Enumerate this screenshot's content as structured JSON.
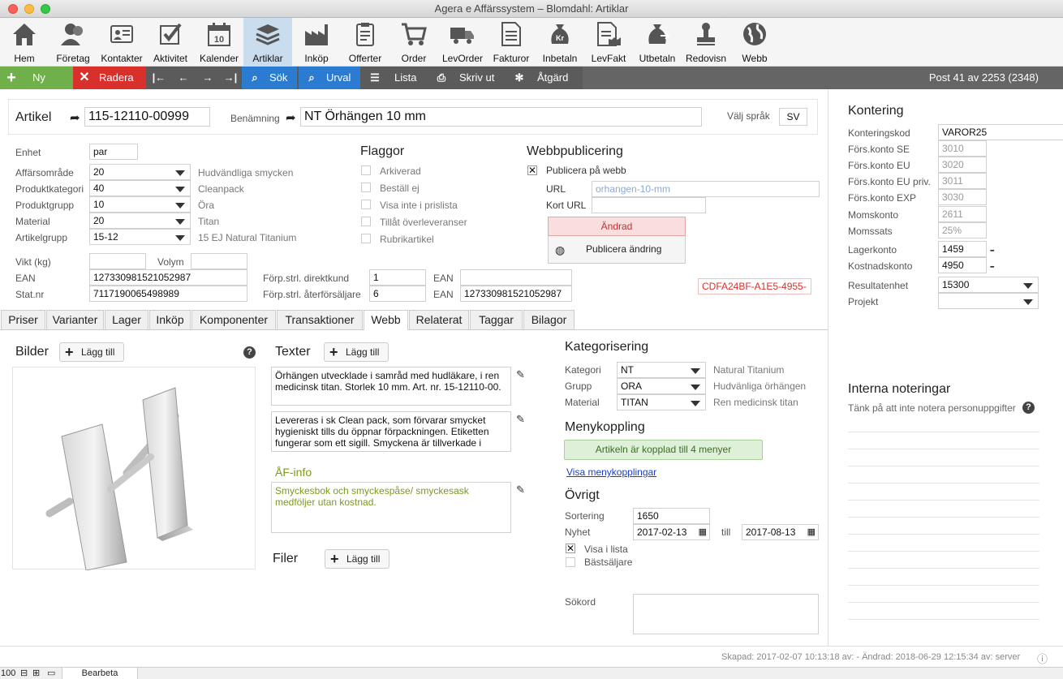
{
  "window": {
    "title": "Agera e Affärssystem – Blomdahl: Artiklar"
  },
  "toolbar": [
    {
      "label": "Hem",
      "icon": "home-icon"
    },
    {
      "label": "Företag",
      "icon": "company-icon"
    },
    {
      "label": "Kontakter",
      "icon": "contacts-icon"
    },
    {
      "label": "Aktivitet",
      "icon": "activity-icon"
    },
    {
      "label": "Kalender",
      "icon": "calendar-icon"
    },
    {
      "label": "Artiklar",
      "icon": "articles-icon"
    },
    {
      "label": "Inköp",
      "icon": "purchase-icon"
    },
    {
      "label": "Offerter",
      "icon": "quotes-icon"
    },
    {
      "label": "Order",
      "icon": "cart-icon"
    },
    {
      "label": "LevOrder",
      "icon": "truck-icon"
    },
    {
      "label": "Fakturor",
      "icon": "invoice-icon"
    },
    {
      "label": "Inbetaln",
      "icon": "money-bag-icon"
    },
    {
      "label": "LevFakt",
      "icon": "supplier-invoice-icon"
    },
    {
      "label": "Utbetaln",
      "icon": "payout-icon"
    },
    {
      "label": "Redovisn",
      "icon": "stamp-icon"
    },
    {
      "label": "Webb",
      "icon": "globe-icon"
    }
  ],
  "actions": {
    "new": "Ny",
    "delete": "Radera",
    "search": "Sök",
    "filter": "Urval",
    "list": "Lista",
    "print": "Skriv ut",
    "action": "Åtgärd",
    "post_info": "Post 41 av 2253 (2348)"
  },
  "colors": {
    "new": "#6fb04a",
    "delete": "#d9302c",
    "search": "#2b7bd0",
    "active_tab": "#c9ddef"
  },
  "article": {
    "label": "Artikel",
    "number": "115-12110-00999",
    "name_label": "Benämning",
    "name": "NT Örhängen 10 mm",
    "lang_label": "Välj språk",
    "lang": "SV"
  },
  "props": {
    "unit_label": "Enhet",
    "unit": "par",
    "rows": [
      {
        "label": "Affärsområde",
        "value": "20",
        "desc": "Hudvändliga smycken"
      },
      {
        "label": "Produktkategori",
        "value": "40",
        "desc": "Cleanpack"
      },
      {
        "label": "Produktgrupp",
        "value": "10",
        "desc": "Öra"
      },
      {
        "label": "Material",
        "value": "20",
        "desc": "Titan"
      },
      {
        "label": "Artikelgrupp",
        "value": "15-12",
        "desc": "15 EJ Natural Titanium"
      }
    ],
    "weight_label": "Vikt (kg)",
    "weight": "",
    "volume_label": "Volym",
    "volume": "",
    "ean_label": "EAN",
    "ean": "127330981521052987",
    "stat_label": "Stat.nr",
    "stat": "7117190065498989",
    "pack_direct_label": "Förp.strl. direktkund",
    "pack_direct": "1",
    "ean2_label": "EAN",
    "ean2": "",
    "pack_retail_label": "Förp.strl. återförsäljare",
    "pack_retail": "6",
    "ean3_label": "EAN",
    "ean3": "127330981521052987",
    "guid": "CDFA24BF-A1E5-4955-"
  },
  "flags": {
    "title": "Flaggor",
    "items": [
      {
        "label": "Arkiverad",
        "checked": false
      },
      {
        "label": "Beställ ej",
        "checked": false
      },
      {
        "label": "Visa inte i prislista",
        "checked": false
      },
      {
        "label": "Tillåt överleveranser",
        "checked": false
      },
      {
        "label": "Rubrikartikel",
        "checked": false
      }
    ]
  },
  "web": {
    "title": "Webbpublicering",
    "publish_label": "Publicera på webb",
    "publish_mark": "✕",
    "url_label": "URL",
    "url": "orhangen-10-mm",
    "short_label": "Kort URL",
    "short": "",
    "changed": "Ändrad",
    "publish_button": "Publicera ändring"
  },
  "tabs": [
    "Priser",
    "Varianter",
    "Lager",
    "Inköp",
    "Komponenter",
    "Transaktioner",
    "Webb",
    "Relaterat",
    "Taggar",
    "Bilagor"
  ],
  "active_tab": "Webb",
  "webtab": {
    "images_title": "Bilder",
    "add": "Lägg till",
    "help": "?",
    "texts_title": "Texter",
    "text1": "Örhängen utvecklade i samråd med hudläkare, i ren medicinsk titan. Storlek 10 mm. Art. nr. 15-12110-00.",
    "text2": "Levereras i sk Clean pack, som förvarar smycket hygieniskt tills du öppnar förpackningen. Etiketten fungerar som ett sigill. Smyckena är tillverkade i",
    "af_title": "ÅF-info",
    "af_text": "Smyckesbok och smyckespåse/ smyckesask medföljer utan kostnad.",
    "files_title": "Filer",
    "cat_title": "Kategorisering",
    "cats": [
      {
        "label": "Kategori",
        "value": "NT",
        "desc": "Natural Titanium"
      },
      {
        "label": "Grupp",
        "value": "ORA",
        "desc": "Hudvänliga örhängen"
      },
      {
        "label": "Material",
        "value": "TITAN",
        "desc": "Ren medicinsk titan"
      }
    ],
    "menu_title": "Menykoppling",
    "menu_status": "Artikeln är kopplad till 4 menyer",
    "menu_link": "Visa menykopplingar",
    "other_title": "Övrigt",
    "sort_label": "Sortering",
    "sort": "1650",
    "news_label": "Nyhet",
    "news_from": "2017-02-13",
    "till": "till",
    "news_to": "2017-08-13",
    "show_list_label": "Visa i lista",
    "show_list_mark": "✕",
    "best_label": "Bästsäljare",
    "search_label": "Sökord",
    "search": ""
  },
  "kontering": {
    "title": "Kontering",
    "rows": [
      {
        "label": "Konteringskod",
        "value": "VAROR25"
      },
      {
        "label": "Förs.konto SE",
        "value": "3010"
      },
      {
        "label": "Förs.konto EU",
        "value": "3020"
      },
      {
        "label": "Förs.konto EU priv.",
        "value": "3011"
      },
      {
        "label": "Förs.konto EXP",
        "value": "3030"
      },
      {
        "label": "Momskonto",
        "value": "2611"
      },
      {
        "label": "Momssats",
        "value": "25%"
      },
      {
        "label": "Lagerkonto",
        "value": "1459"
      },
      {
        "label": "Kostnadskonto",
        "value": "4950"
      },
      {
        "label": "Resultatenhet",
        "value": "15300"
      },
      {
        "label": "Projekt",
        "value": ""
      }
    ],
    "dots": "▪▪▪"
  },
  "notes": {
    "title": "Interna noteringar",
    "hint": "Tänk på att inte notera personuppgifter",
    "help": "?"
  },
  "footer": {
    "created": "Skapad: 2017-02-07 10:13:18 av:  - Ändrad: 2018-06-29 12:15:34 av: server",
    "info": "ⓘ"
  },
  "statusbar": {
    "zoom": "100",
    "mode": "Bearbeta"
  }
}
